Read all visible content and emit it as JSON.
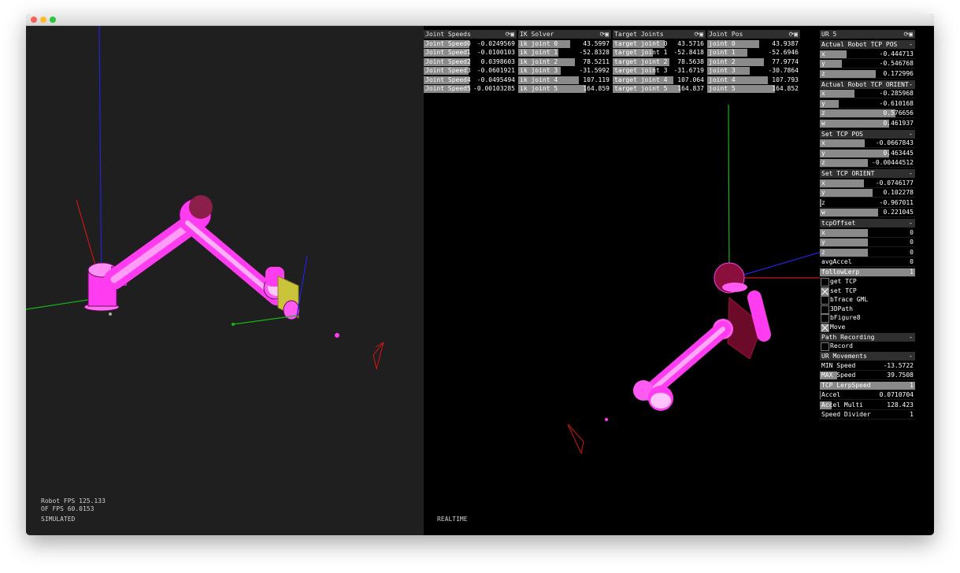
{
  "colors": {
    "robot": "#ff3cf0",
    "x_axis": "#d01515",
    "y_axis": "#16b31a",
    "z_axis": "#2222dd",
    "left_bg": "#1f1f1f",
    "right_bg": "#000000"
  },
  "hud_left": {
    "robot_fps": "Robot FPS 125.133",
    "of_fps": "OF FPS 60.0153",
    "mode": "SIMULATED"
  },
  "hud_right": {
    "mode": "REALTIME"
  },
  "panels": [
    {
      "title": "Joint Speeds",
      "rows": [
        {
          "label": "Joint Speed0",
          "value": "-0.0249569",
          "fill": 0.49
        },
        {
          "label": "Joint Speed1",
          "value": "-0.0100103",
          "fill": 0.49
        },
        {
          "label": "Joint Speed2",
          "value": "0.0398603",
          "fill": 0.5
        },
        {
          "label": "Joint Speed3",
          "value": "-0.0601921",
          "fill": 0.48
        },
        {
          "label": "Joint Speed4",
          "value": "-0.0495494",
          "fill": 0.49
        },
        {
          "label": "Joint Speed5",
          "value": "-0.00103285",
          "fill": 0.5
        }
      ]
    },
    {
      "title": "IK Solver",
      "rows": [
        {
          "label": "ik joint 0",
          "value": "43.5997",
          "fill": 0.56
        },
        {
          "label": "ik joint 1",
          "value": "-52.8328",
          "fill": 0.43
        },
        {
          "label": "ik joint 2",
          "value": "78.5211",
          "fill": 0.61
        },
        {
          "label": "ik joint 3",
          "value": "-31.5992",
          "fill": 0.46
        },
        {
          "label": "ik joint 4",
          "value": "107.119",
          "fill": 0.65
        },
        {
          "label": "ik joint 5",
          "value": "164.859",
          "fill": 0.73
        }
      ]
    },
    {
      "title": "Target Joints",
      "rows": [
        {
          "label": "target joint 0",
          "value": "43.5716",
          "fill": 0.56
        },
        {
          "label": "target joint 1",
          "value": "-52.8418",
          "fill": 0.43
        },
        {
          "label": "target joint 2",
          "value": "78.5638",
          "fill": 0.61
        },
        {
          "label": "target joint 3",
          "value": "-31.6719",
          "fill": 0.46
        },
        {
          "label": "target joint 4",
          "value": "107.064",
          "fill": 0.65
        },
        {
          "label": "target joint 5",
          "value": "164.837",
          "fill": 0.73
        }
      ]
    },
    {
      "title": "Joint Pos",
      "rows": [
        {
          "label": "joint 0",
          "value": "43.9387",
          "fill": 0.56
        },
        {
          "label": "joint 1",
          "value": "-52.6946",
          "fill": 0.43
        },
        {
          "label": "joint 2",
          "value": "77.9774",
          "fill": 0.61
        },
        {
          "label": "joint 3",
          "value": "-30.7864",
          "fill": 0.46
        },
        {
          "label": "joint 4",
          "value": "107.793",
          "fill": 0.65
        },
        {
          "label": "joint 5",
          "value": "164.852",
          "fill": 0.73
        }
      ]
    }
  ],
  "ur5": {
    "title": "UR 5",
    "sections": [
      {
        "title": "Actual Robot TCP POS",
        "rows": [
          {
            "label": "x",
            "value": "-0.444713",
            "fill": 0.28
          },
          {
            "label": "y",
            "value": "-0.546768",
            "fill": 0.23
          },
          {
            "label": "z",
            "value": "0.172996",
            "fill": 0.59
          }
        ]
      },
      {
        "title": "Actual Robot TCP ORIENT",
        "rows": [
          {
            "label": "x",
            "value": "-0.285968",
            "fill": 0.36
          },
          {
            "label": "y",
            "value": "-0.610168",
            "fill": 0.2
          },
          {
            "label": "z",
            "value": "0.576656",
            "fill": 0.79
          },
          {
            "label": "w",
            "value": "0.461937",
            "fill": 0.73
          }
        ]
      },
      {
        "title": "Set TCP POS",
        "rows": [
          {
            "label": "x",
            "value": "-0.0667843",
            "fill": 0.47
          },
          {
            "label": "y",
            "value": "0.463445",
            "fill": 0.73
          },
          {
            "label": "z",
            "value": "-0.00444512",
            "fill": 0.5
          }
        ]
      },
      {
        "title": "Set TCP ORIENT",
        "rows": [
          {
            "label": "x",
            "value": "-0.0746177",
            "fill": 0.46
          },
          {
            "label": "y",
            "value": "0.102278",
            "fill": 0.55
          },
          {
            "label": "z",
            "value": "-0.967011",
            "fill": 0.02
          },
          {
            "label": "w",
            "value": "0.221045",
            "fill": 0.61
          }
        ]
      },
      {
        "title": "tcpOffset",
        "rows": [
          {
            "label": "x",
            "value": "0",
            "fill": 0.5
          },
          {
            "label": "y",
            "value": "0",
            "fill": 0.5
          },
          {
            "label": "z",
            "value": "0",
            "fill": 0.5
          }
        ]
      }
    ],
    "avg_accel": {
      "label": "avgAccel",
      "value": "0",
      "fill": 0.0
    },
    "follow_lerp": {
      "label": "followLerp",
      "value": "1",
      "fill": 1.0
    },
    "toggles": [
      {
        "label": "get TCP",
        "checked": false
      },
      {
        "label": "set TCP",
        "checked": true
      },
      {
        "label": "bTrace GML",
        "checked": false
      },
      {
        "label": "3DPath",
        "checked": false
      },
      {
        "label": "bFigure8",
        "checked": false
      },
      {
        "label": "Move",
        "checked": true
      }
    ],
    "path_recording": {
      "title": "Path Recording",
      "record_label": "Record",
      "checked": false
    },
    "movements": {
      "title": "UR Movements",
      "rows": [
        {
          "label": "MIN Speed",
          "value": "-13.5722",
          "fill": 0.0
        },
        {
          "label": "MAX Speed",
          "value": "39.7508",
          "fill": 0.18
        },
        {
          "label": "TCP LerpSpeed",
          "value": "1",
          "fill": 1.0
        },
        {
          "label": "Accel",
          "value": "0.0710704",
          "fill": 0.01
        },
        {
          "label": "Accel Multi",
          "value": "128.423",
          "fill": 0.12
        },
        {
          "label": "Speed Divider",
          "value": "1",
          "fill": 0.0
        }
      ]
    }
  }
}
